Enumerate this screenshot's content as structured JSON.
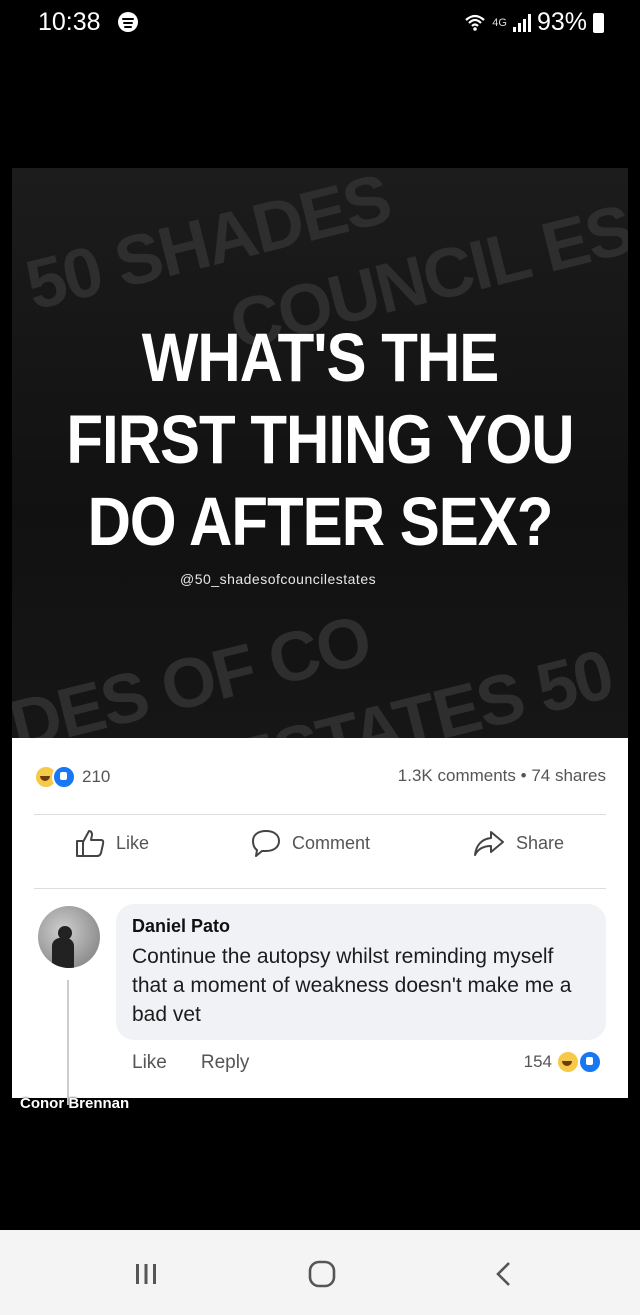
{
  "status_bar": {
    "time": "10:38",
    "network": "4G",
    "battery": "93%"
  },
  "meme": {
    "background_words": [
      "50 SHADES",
      "COUNCIL ES",
      "DES OF CO",
      "ESTATES 50"
    ],
    "headline": [
      "WHAT'S THE",
      "FIRST THING YOU",
      "DO AFTER SEX?"
    ],
    "watermark": "@50_shadesofcouncilestates"
  },
  "post": {
    "reaction_count": "210",
    "comments": "1.3K comments",
    "separator": "•",
    "shares": "74 shares",
    "actions": {
      "like": "Like",
      "comment": "Comment",
      "share": "Share"
    }
  },
  "comment": {
    "author": "Daniel Pato",
    "text": "Continue the autopsy whilst reminding myself that a moment of weakness doesn't make me a bad vet",
    "like": "Like",
    "reply": "Reply",
    "reaction_count": "154"
  },
  "overlay": {
    "name": "Conor Brennan"
  },
  "icons": {
    "spotify": "spotify-icon",
    "wifi": "wifi-icon",
    "signal": "signal-icon",
    "battery": "battery-icon",
    "like": "thumbs-up-icon",
    "comment": "speech-bubble-icon",
    "share": "share-arrow-icon",
    "recent": "recent-apps-icon",
    "home": "home-icon",
    "back": "back-icon"
  },
  "colors": {
    "facebook_blue": "#1877f2",
    "haha_yellow": "#f7c948",
    "bubble_bg": "#f0f2f5"
  }
}
